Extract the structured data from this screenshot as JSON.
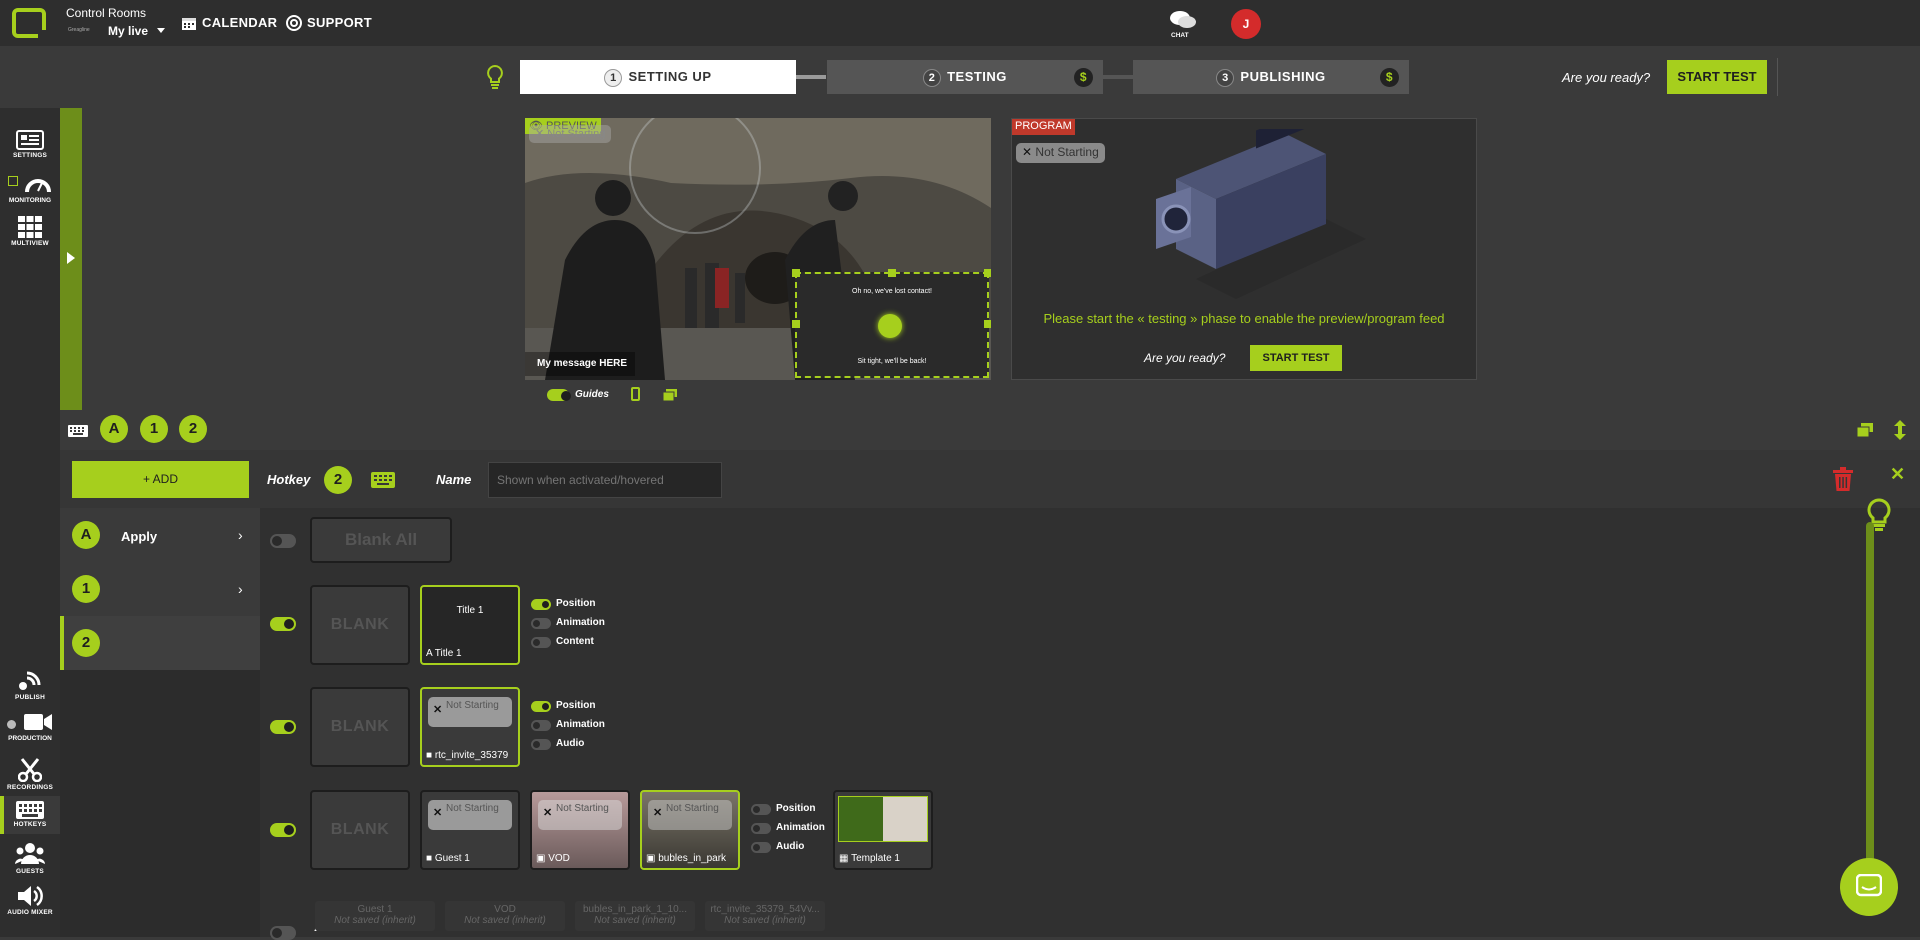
{
  "topbar": {
    "app_title": "Control Rooms",
    "org": "Greagline",
    "room": "My live",
    "nav_calendar": "CALENDAR",
    "nav_support": "SUPPORT",
    "chat": "CHAT",
    "avatar_initial": "J"
  },
  "steps": {
    "s1_num": "1",
    "s1_label": "SETTING UP",
    "s2_num": "2",
    "s2_label": "TESTING",
    "s3_num": "3",
    "s3_label": "PUBLISHING",
    "dollar": "$",
    "ready_text": "Are you ready?",
    "start_test": "START TEST"
  },
  "rail": {
    "settings": "SETTINGS",
    "monitoring": "MONITORING",
    "multiview": "MULTIVIEW",
    "publish": "PUBLISH",
    "production": "PRODUCTION",
    "recordings": "RECORDINGS",
    "hotkeys": "HOTKEYS",
    "guests": "GUESTS",
    "audio_mixer": "AUDIO MIXER"
  },
  "preview": {
    "label": "PREVIEW",
    "status": "Not Starting",
    "lower_third": "My message HERE",
    "overlay_top": "Oh no, we've lost contact!",
    "overlay_bottom": "Sit tight, we'll be back!",
    "guides": "Guides"
  },
  "program": {
    "label": "PROGRAM",
    "status": "Not Starting",
    "message": "Please start the « testing » phase to enable the preview/program feed",
    "ready_text": "Are you ready?",
    "start_test": "START TEST"
  },
  "hotkeybar": {
    "tab_a": "A",
    "tab_1": "1",
    "tab_2": "2"
  },
  "editor": {
    "add": "+ ADD",
    "hotkey_label": "Hotkey",
    "hotkey_value": "2",
    "name_label": "Name",
    "name_placeholder": "Shown when activated/hovered",
    "list": [
      {
        "key": "A",
        "label": "Apply"
      },
      {
        "key": "1",
        "label": ""
      },
      {
        "key": "2",
        "label": ""
      }
    ],
    "blank_all": "Blank All",
    "blank": "BLANK",
    "row1": {
      "title_thumb": "Title 1",
      "caption": "Title 1",
      "opt1": "Position",
      "opt2": "Animation",
      "opt3": "Content"
    },
    "row2": {
      "ns": "Not Starting",
      "caption": "rtc_invite_35379",
      "opt1": "Position",
      "opt2": "Animation",
      "opt3": "Audio"
    },
    "row3": {
      "ns": "Not Starting",
      "c1": "Guest 1",
      "c2": "VOD",
      "c3": "bubles_in_park",
      "c4": "Template 1",
      "opt1": "Position",
      "opt2": "Animation",
      "opt3": "Audio"
    },
    "audio_label": "Audio",
    "ghost": [
      {
        "name": "Guest 1",
        "state": "Not saved (inherit)"
      },
      {
        "name": "VOD",
        "state": "Not saved (inherit)"
      },
      {
        "name": "bubles_in_park_1_10...",
        "state": "Not saved (inherit)"
      },
      {
        "name": "rtc_invite_35379_54Vv...",
        "state": "Not saved (inherit)"
      }
    ]
  },
  "colors": {
    "accent": "#a6cf1d",
    "danger": "#d42b2b",
    "bg": "#3a3a3a",
    "panel": "#2e2e2e"
  }
}
